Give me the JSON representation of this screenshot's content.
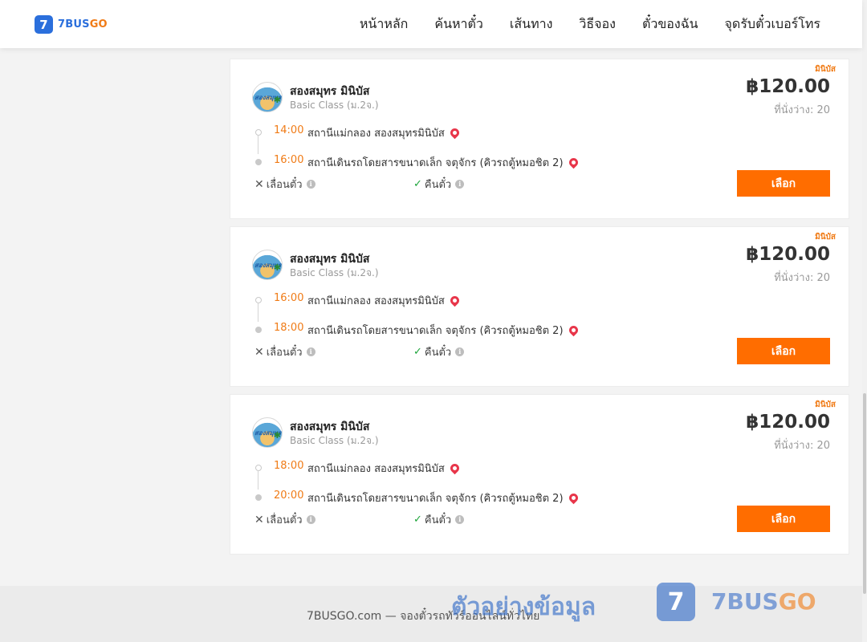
{
  "header": {
    "logo_mark": "7",
    "logo_text_a": "7BUS",
    "logo_text_b": "GO",
    "nav": [
      "หน้าหลัก",
      "ค้นหาตั๋ว",
      "เส้นทาง",
      "วิธีจอง",
      "ตั๋วของฉัน",
      "จุดรับตั๋วเบอร์โทร"
    ]
  },
  "labels": {
    "change": "เลื่อนตั๋ว",
    "refund": "คืนตั๋ว",
    "select": "เลือก",
    "info": "i"
  },
  "trips": [
    {
      "tag": "มินิบัส",
      "operator": "สองสมุทร มินิบัส",
      "logo_text": "สองสมุทร",
      "class": "Basic Class (ม.2จ.)",
      "price": "฿120.00",
      "seats": "ที่นั่งว่าง: 20",
      "depart_time": "14:00",
      "depart_place": "สถานีแม่กลอง สองสมุทรมินิบัส",
      "arrive_time": "16:00",
      "arrive_place": "สถานีเดินรถโดยสารขนาดเล็ก จตุจักร (คิวรถตู้หมอชิต 2)"
    },
    {
      "tag": "มินิบัส",
      "operator": "สองสมุทร มินิบัส",
      "logo_text": "สองสมุทร",
      "class": "Basic Class (ม.2จ.)",
      "price": "฿120.00",
      "seats": "ที่นั่งว่าง: 20",
      "depart_time": "16:00",
      "depart_place": "สถานีแม่กลอง สองสมุทรมินิบัส",
      "arrive_time": "18:00",
      "arrive_place": "สถานีเดินรถโดยสารขนาดเล็ก จตุจักร (คิวรถตู้หมอชิต 2)"
    },
    {
      "tag": "มินิบัส",
      "operator": "สองสมุทร มินิบัส",
      "logo_text": "สองสมุทร",
      "class": "Basic Class (ม.2จ.)",
      "price": "฿120.00",
      "seats": "ที่นั่งว่าง: 20",
      "depart_time": "18:00",
      "depart_place": "สถานีแม่กลอง สองสมุทรมินิบัส",
      "arrive_time": "20:00",
      "arrive_place": "สถานีเดินรถโดยสารขนาดเล็ก จตุจักร (คิวรถตู้หมอชิต 2)"
    }
  ],
  "footer": {
    "text": "7BUSGO.com — จองตั๋วรถทัวร์ออนไลน์ทั่วไทย"
  },
  "watermark": {
    "text": "ตัวอย่างข้อมูล",
    "badge": "7",
    "brand_a": "7BUS",
    "brand_b": "GO"
  },
  "colors": {
    "accent": "#ff6d00",
    "time": "#f07b16",
    "brand_blue": "#2b6fdc",
    "pin": "#e8364a",
    "check": "#1da43a"
  }
}
